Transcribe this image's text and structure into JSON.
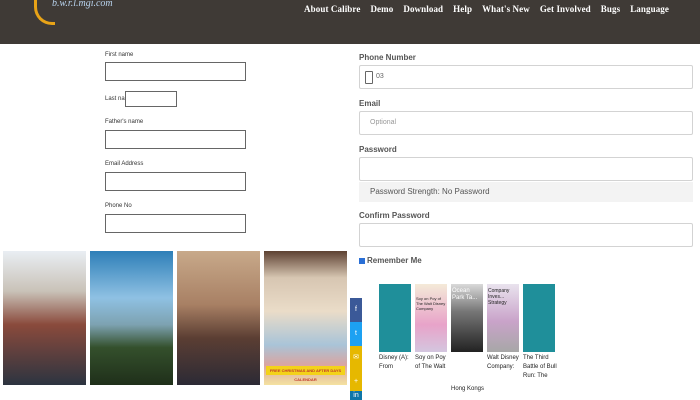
{
  "header": {
    "logo_text": "b.w.r.l.mgi.com",
    "nav": [
      "About Calibre",
      "Demo",
      "Download",
      "Help",
      "What's New",
      "Get Involved",
      "Bugs",
      "Language"
    ]
  },
  "left_form": {
    "first_name": "First name",
    "last_name": "Last name",
    "fathers_name": "Father's name",
    "email_address": "Email Address",
    "phone_no": "Phone No"
  },
  "right_form": {
    "phone_label": "Phone Number",
    "phone_value": "03",
    "email_label": "Email",
    "email_placeholder": "Optional",
    "password_label": "Password",
    "password_strength": "Password Strength: No Password",
    "confirm_label": "Confirm Password",
    "remember_label": "Remember Me"
  },
  "promo_banner": "FREE CHRISTMAS AND AFTER DAYS CALENDAR",
  "social": [
    "f",
    "t",
    "✉",
    "+",
    "in"
  ],
  "social_colors": [
    "#3b5998",
    "#1da1f2",
    "#e6b800",
    "#e6b800",
    "#0e76a8"
  ],
  "books": [
    {
      "title": "Disney (A): From",
      "cover_text": ""
    },
    {
      "title": "Soy on Poy of The Walt",
      "cover_text": "Soy on Poy of The Walt Disney Company"
    },
    {
      "title": "Hong Kongs",
      "cover_text": "Ocean Park Ta..."
    },
    {
      "title": "Walt Disney Company:",
      "cover_text": "Company Inves... Strategy"
    },
    {
      "title": "The Third Battle of Bull Run: The",
      "cover_text": ""
    }
  ]
}
